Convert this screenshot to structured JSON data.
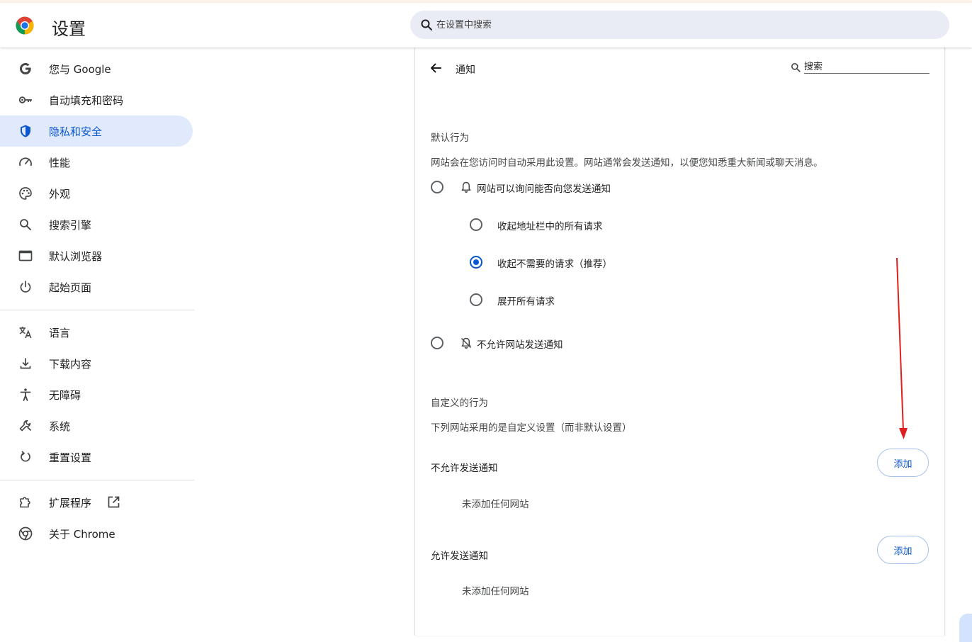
{
  "app": {
    "title": "设置"
  },
  "search": {
    "placeholder": "在设置中搜索"
  },
  "sidebar": {
    "items": [
      {
        "label": "您与 Google",
        "icon": "google-g-icon"
      },
      {
        "label": "自动填充和密码",
        "icon": "key-icon"
      },
      {
        "label": "隐私和安全",
        "icon": "shield-icon",
        "active": true
      },
      {
        "label": "性能",
        "icon": "speedometer-icon"
      },
      {
        "label": "外观",
        "icon": "palette-icon"
      },
      {
        "label": "搜索引擎",
        "icon": "search-icon"
      },
      {
        "label": "默认浏览器",
        "icon": "browser-window-icon"
      },
      {
        "label": "起始页面",
        "icon": "power-icon"
      },
      {
        "label": "语言",
        "icon": "translate-icon"
      },
      {
        "label": "下载内容",
        "icon": "download-icon"
      },
      {
        "label": "无障碍",
        "icon": "accessibility-icon"
      },
      {
        "label": "系统",
        "icon": "wrench-icon"
      },
      {
        "label": "重置设置",
        "icon": "reset-icon"
      },
      {
        "label": "扩展程序",
        "icon": "puzzle-icon"
      },
      {
        "label": "关于 Chrome",
        "icon": "chrome-icon"
      }
    ]
  },
  "panel": {
    "title": "通知",
    "search_placeholder": "搜索",
    "default_section": {
      "heading": "默认行为",
      "description": "网站会在您访问时自动采用此设置。网站通常会发送通知，以便您知悉重大新闻或聊天消息。",
      "options": {
        "ask": "网站可以询问能否向您发送通知",
        "collapse_all": "收起地址栏中的所有请求",
        "collapse_unwanted": "收起不需要的请求（推荐）",
        "expand_all": "展开所有请求",
        "block": "不允许网站发送通知"
      },
      "selected": "collapse_unwanted"
    },
    "custom_section": {
      "heading": "自定义的行为",
      "description": "下列网站采用的是自定义设置（而非默认设置）",
      "blocked": {
        "label": "不允许发送通知",
        "add_label": "添加",
        "empty": "未添加任何网站"
      },
      "allowed": {
        "label": "允许发送通知",
        "add_label": "添加",
        "empty": "未添加任何网站"
      }
    }
  },
  "colors": {
    "accent": "#0b57d0",
    "active_bg": "#e1eafd",
    "annotation_arrow": "#e02020"
  }
}
